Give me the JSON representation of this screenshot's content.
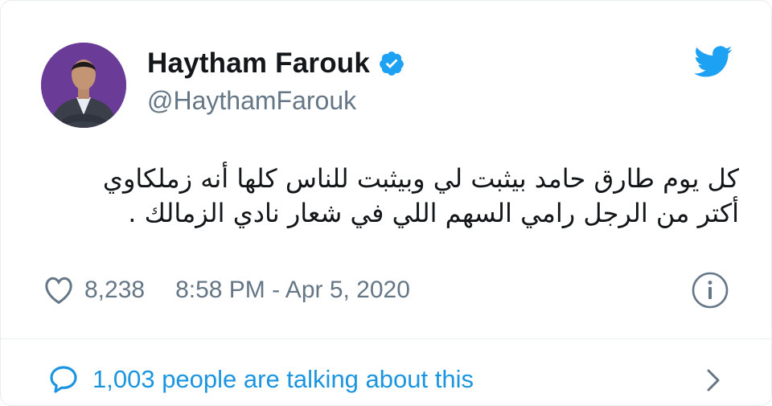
{
  "author": {
    "display_name": "Haytham Farouk",
    "handle": "@HaythamFarouk",
    "verified": true,
    "verified_icon": "verified-badge-icon",
    "avatar_icon": "profile-photo"
  },
  "brand": {
    "icon": "twitter-bird-icon",
    "color": "#1da1f2"
  },
  "tweet": {
    "lines": [
      "كل يوم طارق حامد بيثبت لي وبيثبت للناس كلها أنه زملكاوي",
      "أكتر من الرجل رامي السهم اللي في شعار نادي الزمالك ."
    ]
  },
  "meta": {
    "like_icon": "heart-icon",
    "like_count": "8,238",
    "timestamp": "8:58 PM - Apr 5, 2020",
    "info_icon": "info-icon"
  },
  "footer": {
    "reply_icon": "speech-bubble-icon",
    "conversation_text": "1,003 people are talking about this",
    "chevron_icon": "chevron-right-icon"
  },
  "colors": {
    "link": "#1b95e0",
    "secondary_text": "#657786",
    "primary_text": "#14171a",
    "border": "#e6ecf0"
  }
}
